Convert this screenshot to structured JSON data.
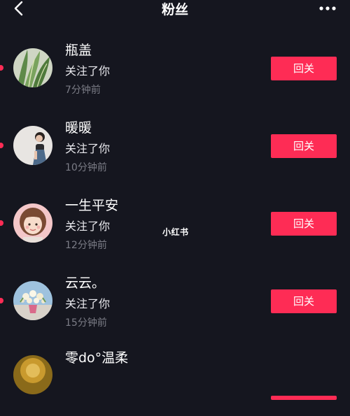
{
  "header": {
    "title": "粉丝",
    "back_icon": "chevron-left-icon",
    "more_icon": "more-horizontal-icon"
  },
  "fans": [
    {
      "name": "瓶盖",
      "action": "关注了你",
      "time": "7分钟前",
      "button": "回关",
      "avatar_icon": "plant-leaves-avatar"
    },
    {
      "name": "暖暖",
      "action": "关注了你",
      "time": "10分钟前",
      "button": "回关",
      "avatar_icon": "girl-photo-avatar"
    },
    {
      "name": "一生平安",
      "action": "关注了你",
      "time": "12分钟前",
      "button": "回关",
      "avatar_icon": "cartoon-girl-avatar"
    },
    {
      "name": "云云。",
      "action": "关注了你",
      "time": "15分钟前",
      "button": "回关",
      "avatar_icon": "flower-bouquet-avatar"
    },
    {
      "name": "零do°温柔",
      "action": "",
      "time": "",
      "button": "",
      "avatar_icon": "golden-avatar"
    }
  ],
  "watermark": "小红书",
  "colors": {
    "background": "#15161f",
    "accent": "#fe2c55",
    "secondary_text": "#7b7c86"
  }
}
